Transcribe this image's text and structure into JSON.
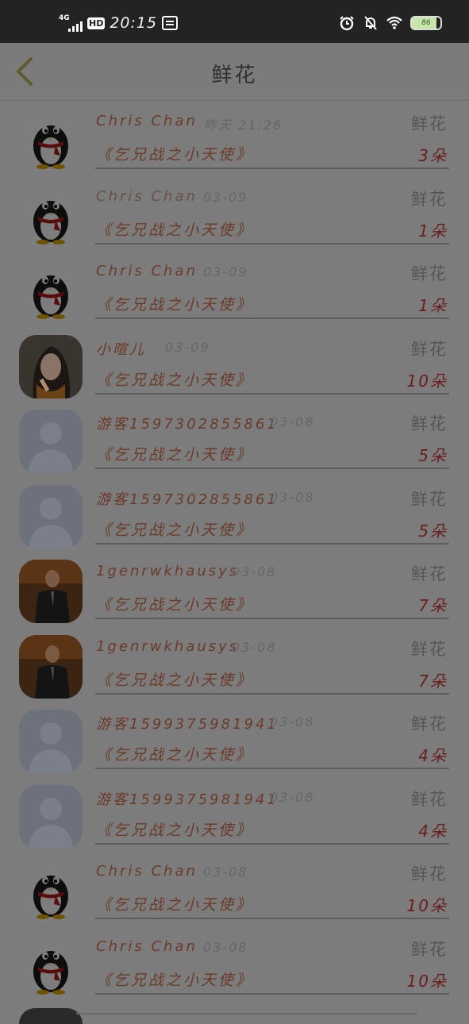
{
  "status": {
    "network": "4G",
    "hd": "HD",
    "time": "20:15",
    "battery": "86"
  },
  "header": {
    "title": "鲜花"
  },
  "rows": [
    {
      "name": "Chris Chan",
      "date": "昨天 21:26",
      "gift": "鲜花",
      "book": "《乞兄战之小天使》",
      "qty": "3朵",
      "avatar": "penguin"
    },
    {
      "name": "Chris Chan",
      "date": "03-09",
      "gift": "鲜花",
      "book": "《乞兄战之小天使》",
      "qty": "1朵",
      "avatar": "penguin"
    },
    {
      "name": "Chris Chan",
      "date": "03-09",
      "gift": "鲜花",
      "book": "《乞兄战之小天使》",
      "qty": "1朵",
      "avatar": "penguin"
    },
    {
      "name": "小暄儿",
      "date": "03-09",
      "gift": "鲜花",
      "book": "《乞兄战之小天使》",
      "qty": "10朵",
      "avatar": "photo-girl"
    },
    {
      "name": "游客15973028558​61",
      "date": "03-08",
      "gift": "鲜花",
      "book": "《乞兄战之小天使》",
      "qty": "5朵",
      "avatar": "default"
    },
    {
      "name": "游客1597302855861",
      "date": "03-08",
      "gift": "鲜花",
      "book": "《乞兄战之小天使》",
      "qty": "5朵",
      "avatar": "default"
    },
    {
      "name": "1genrwkhausys",
      "date": "03-08",
      "gift": "鲜花",
      "book": "《乞兄战之小天使》",
      "qty": "7朵",
      "avatar": "photo-man"
    },
    {
      "name": "1genrwkhausys",
      "date": "03-08",
      "gift": "鲜花",
      "book": "《乞兄战之小天使》",
      "qty": "7朵",
      "avatar": "photo-man"
    },
    {
      "name": "游客1599375981941",
      "date": "03-08",
      "gift": "鲜花",
      "book": "《乞兄战之小天使》",
      "qty": "4朵",
      "avatar": "default"
    },
    {
      "name": "游客1599375981941",
      "date": "03-08",
      "gift": "鲜花",
      "book": "《乞兄战之小天使》",
      "qty": "4朵",
      "avatar": "default"
    },
    {
      "name": "Chris Chan",
      "date": "03-08",
      "gift": "鲜花",
      "book": "《乞兄战之小天使》",
      "qty": "10朵",
      "avatar": "penguin"
    },
    {
      "name": "Chris Chan",
      "date": "03-08",
      "gift": "鲜花",
      "book": "《乞兄战之小天使》",
      "qty": "10朵",
      "avatar": "penguin"
    }
  ]
}
